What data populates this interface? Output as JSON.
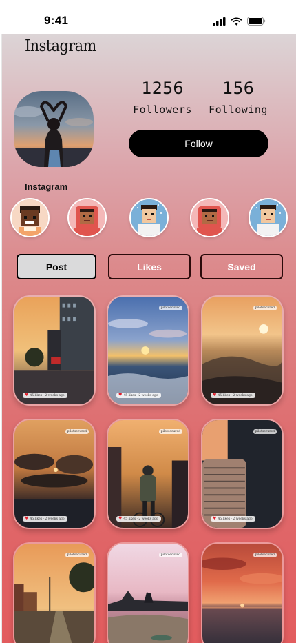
{
  "status": {
    "time": "9:41"
  },
  "app": {
    "brand": "Instagram"
  },
  "profile": {
    "followers_count": "1256",
    "followers_label": "Followers",
    "following_count": "156",
    "following_label": "Following",
    "follow_label": "Follow"
  },
  "highlights": {
    "title": "Instagram"
  },
  "tabs": [
    {
      "label": "Post",
      "active": true
    },
    {
      "label": "Likes",
      "active": false
    },
    {
      "label": "Saved",
      "active": false
    }
  ],
  "posts": [
    {
      "tag": "",
      "meta": "45 likes · 2 weeks ago"
    },
    {
      "tag": "pilotsecured",
      "meta": "45 likes · 2 weeks ago"
    },
    {
      "tag": "pilotsecured",
      "meta": "45 likes · 2 weeks ago"
    },
    {
      "tag": "pilotsecured",
      "meta": "45 likes · 2 weeks ago"
    },
    {
      "tag": "pilotsecured",
      "meta": "45 likes · 2 weeks ago"
    },
    {
      "tag": "pilotsecured",
      "meta": "45 likes · 2 weeks ago"
    },
    {
      "tag": "pilotsecured",
      "meta": ""
    },
    {
      "tag": "pilotsecured",
      "meta": ""
    },
    {
      "tag": "pilotsecured",
      "meta": ""
    }
  ],
  "colors": {
    "accent": "#000000",
    "heart": "#e0202c",
    "gradient_top": "#dcd4d6",
    "gradient_bottom": "#e25c5e"
  }
}
